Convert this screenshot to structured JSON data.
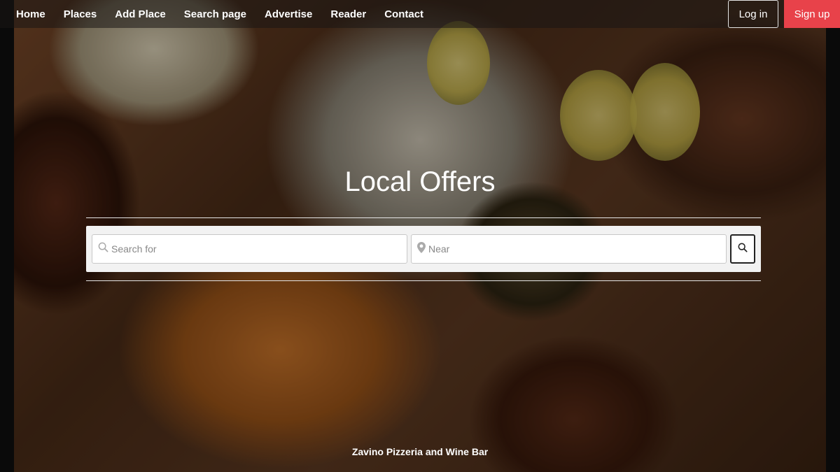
{
  "nav": {
    "links": [
      "Home",
      "Places",
      "Add Place",
      "Search page",
      "Advertise",
      "Reader",
      "Contact"
    ],
    "login_label": "Log in",
    "signup_label": "Sign up"
  },
  "hero": {
    "title": "Local Offers",
    "caption": "Zavino Pizzeria and Wine Bar"
  },
  "search": {
    "search_placeholder": "Search for",
    "near_placeholder": "Near"
  },
  "colors": {
    "signup_bg": "#e8424a",
    "text": "#ffffff"
  },
  "icons": {
    "search_field": "search-icon",
    "near_field": "map-pin-icon",
    "submit": "search-icon"
  }
}
